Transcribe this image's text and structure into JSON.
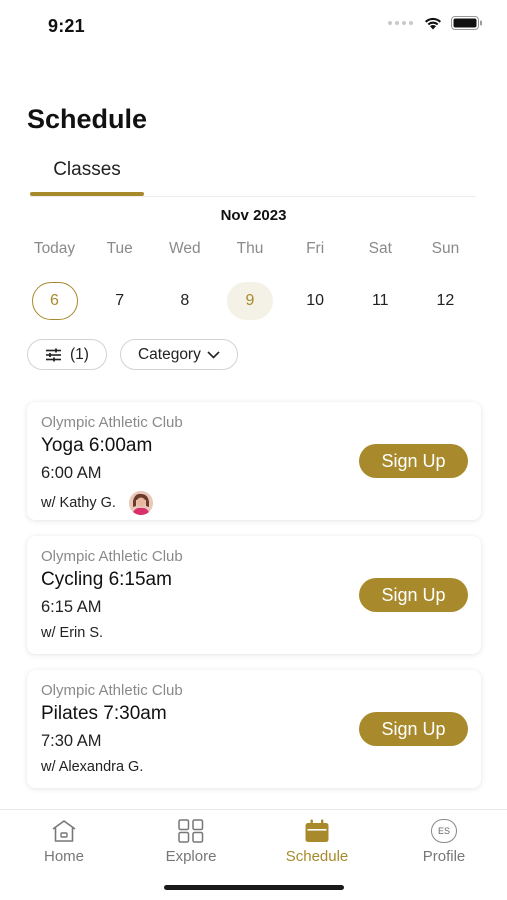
{
  "status": {
    "time": "9:21"
  },
  "page": {
    "title": "Schedule"
  },
  "tabs": [
    {
      "label": "Classes",
      "active": true
    }
  ],
  "calendar": {
    "month": "Nov 2023",
    "days": [
      {
        "weekday": "Today",
        "date": "6",
        "state": "today"
      },
      {
        "weekday": "Tue",
        "date": "7",
        "state": ""
      },
      {
        "weekday": "Wed",
        "date": "8",
        "state": ""
      },
      {
        "weekday": "Thu",
        "date": "9",
        "state": "selected"
      },
      {
        "weekday": "Fri",
        "date": "10",
        "state": ""
      },
      {
        "weekday": "Sat",
        "date": "11",
        "state": ""
      },
      {
        "weekday": "Sun",
        "date": "12",
        "state": ""
      }
    ]
  },
  "filters": {
    "count_label": "(1)",
    "category_label": "Category"
  },
  "classes": [
    {
      "club": "Olympic Athletic Club",
      "title": "Yoga 6:00am",
      "time": "6:00 AM",
      "instructor": "w/ Kathy G.",
      "has_avatar": true,
      "button": "Sign Up"
    },
    {
      "club": "Olympic Athletic Club",
      "title": "Cycling 6:15am",
      "time": "6:15 AM",
      "instructor": "w/ Erin S.",
      "has_avatar": false,
      "button": "Sign Up"
    },
    {
      "club": "Olympic Athletic Club",
      "title": "Pilates 7:30am",
      "time": "7:30 AM",
      "instructor": "w/ Alexandra G.",
      "has_avatar": false,
      "button": "Sign Up"
    }
  ],
  "tabbar": {
    "items": [
      {
        "label": "Home",
        "icon": "home-icon",
        "active": false
      },
      {
        "label": "Explore",
        "icon": "grid-icon",
        "active": false
      },
      {
        "label": "Schedule",
        "icon": "calendar-icon",
        "active": true
      },
      {
        "label": "Profile",
        "icon": "profile-initials-icon",
        "active": false
      }
    ],
    "profile_initials": "ES"
  },
  "colors": {
    "accent": "#a88a2c",
    "accent_light": "#f4f1e6",
    "muted_text": "#8a8a8a"
  }
}
